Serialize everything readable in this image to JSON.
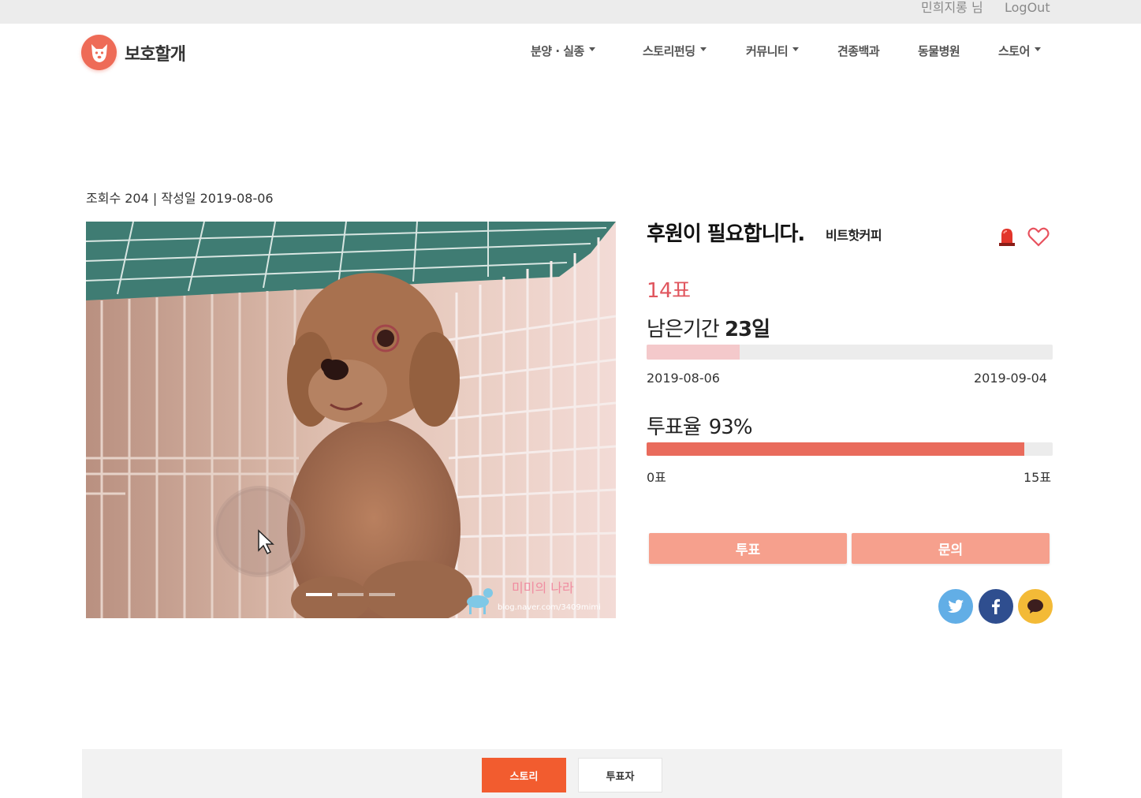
{
  "topbar": {
    "user": "민희지롱 님",
    "logout": "LogOut"
  },
  "nav": {
    "logo_text": "보호할개",
    "menu": [
      "분양 · 실종",
      "스토리펀딩",
      "커뮤니티",
      "견종백과",
      "동물병원",
      "스토어"
    ]
  },
  "post": {
    "meta": "조회수 204 | 작성일 2019-08-06",
    "title": "후원이 필요합니다.",
    "author": "비트핫커피",
    "votes": "14표",
    "remain_label": "남은기간",
    "remain_value": "23일",
    "period_progress": 0.23,
    "start_date": "2019-08-06",
    "end_date": "2019-09-04",
    "rate_label": "투표율",
    "rate_value": "93%",
    "rate_progress": 0.93,
    "min_votes": "0표",
    "max_votes": "15표",
    "vote_button": "투표",
    "inquiry_button": "문의",
    "photo_watermark_name": "미미의 나라",
    "photo_watermark_url": "blog.naver.com/3409mimi",
    "carousel_slides": 3,
    "carousel_active": 1
  },
  "tabs": [
    "스토리",
    "투표자"
  ],
  "colors": {
    "accent": "#f25c2f",
    "vote_bar": "#e96b5c",
    "votes_text": "#e0565e",
    "button": "#f6a08d"
  },
  "icons": {
    "logo": "dog-face-icon",
    "report": "siren-icon",
    "like": "heart-icon",
    "share": [
      "twitter-icon",
      "facebook-icon",
      "kakaotalk-icon"
    ]
  }
}
